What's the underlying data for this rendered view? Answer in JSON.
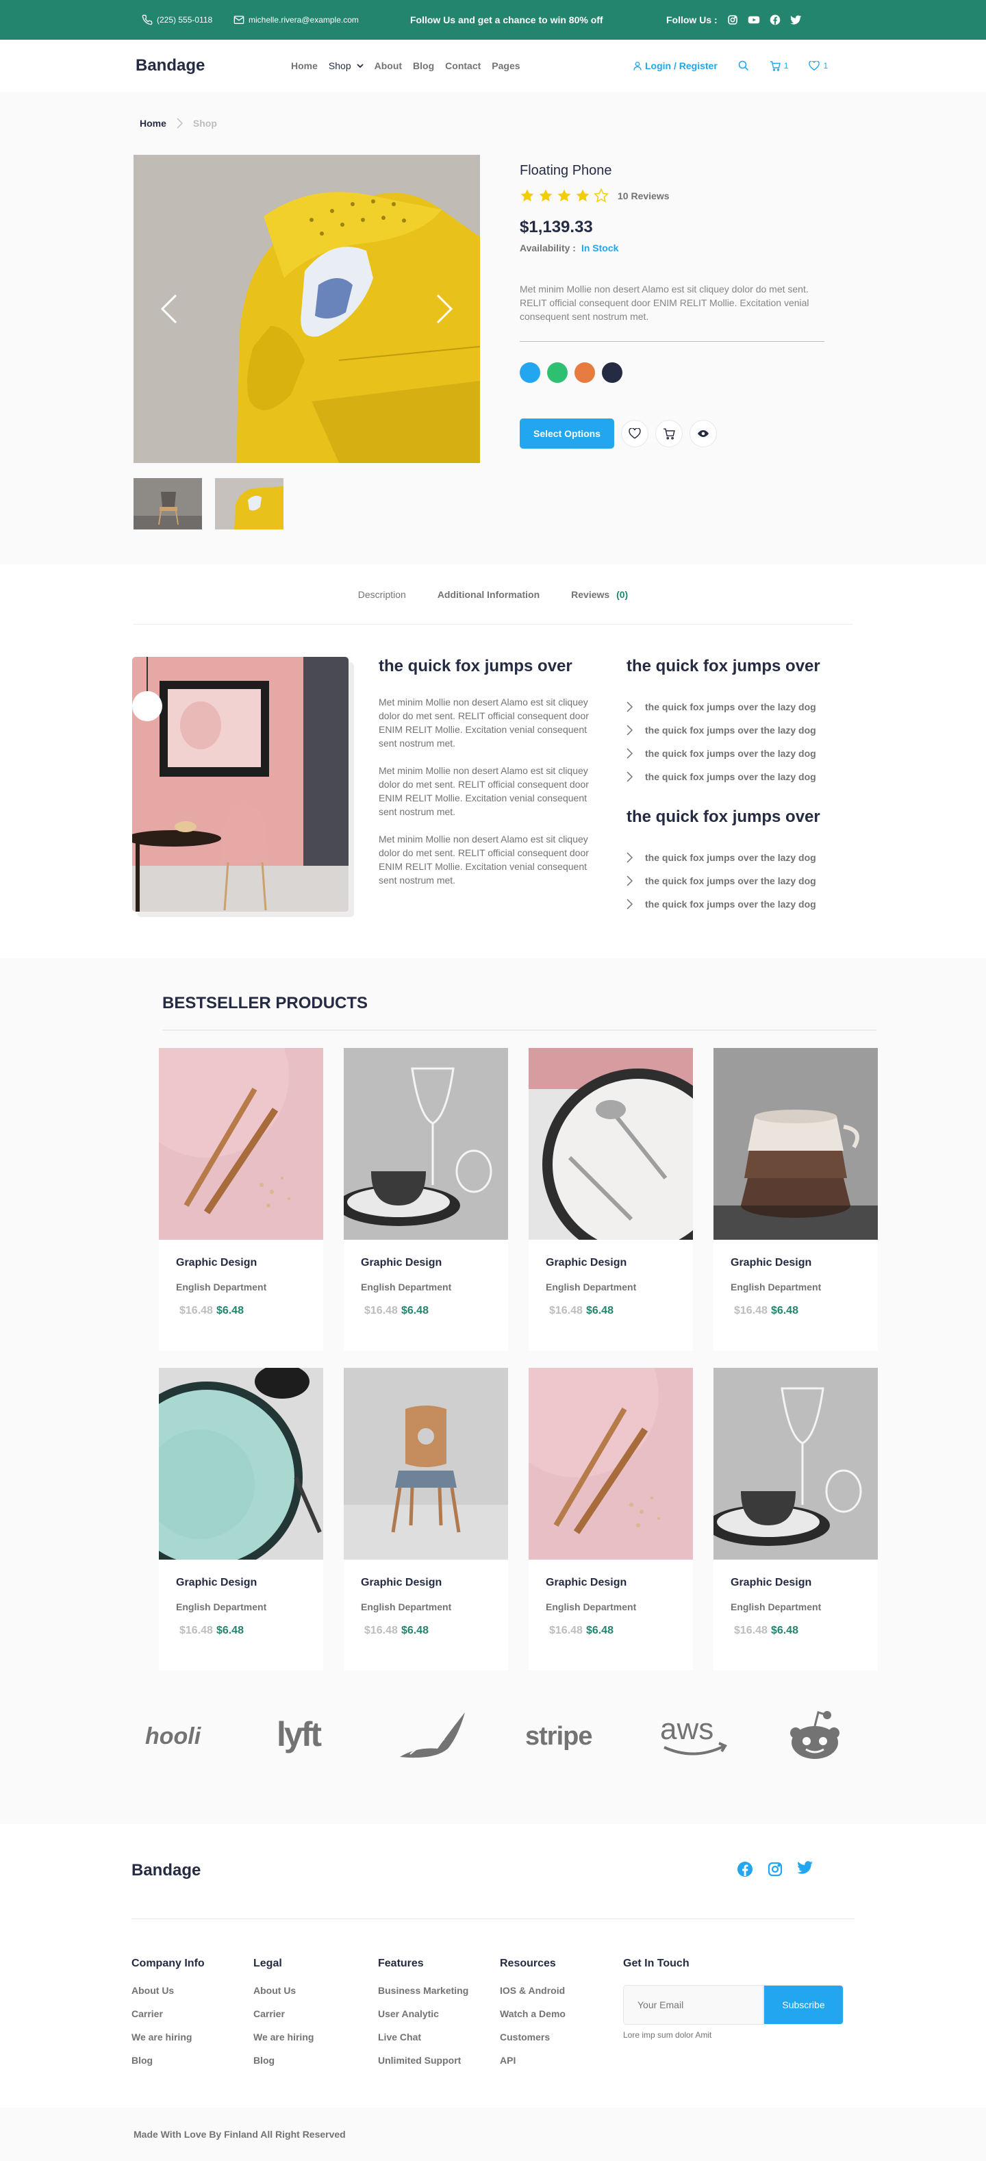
{
  "topbar": {
    "phone": "(225) 555-0118",
    "email": "michelle.rivera@example.com",
    "promo": "Follow Us  and get a chance to win 80% off",
    "follow_label": "Follow Us :"
  },
  "header": {
    "brand": "Bandage",
    "nav": {
      "home": "Home",
      "shop": "Shop",
      "about": "About",
      "blog": "Blog",
      "contact": "Contact",
      "pages": "Pages"
    },
    "login": "Login / Register",
    "cart_count": "1",
    "wishlist_count": "1"
  },
  "breadcrumb": {
    "home": "Home",
    "current": "Shop"
  },
  "product": {
    "name": "Floating Phone",
    "rating": 4,
    "reviews": "10 Reviews",
    "price": "$1,139.33",
    "availability_label": "Availability  :",
    "availability_value": "In Stock",
    "description": "Met minim Mollie non desert Alamo est sit cliquey dolor do met sent. RELIT official consequent door ENIM RELIT Mollie. Excitation venial consequent sent nostrum met.",
    "colors": [
      "#23A6F0",
      "#2DC071",
      "#E77C40",
      "#252B42"
    ],
    "select_options": "Select Options"
  },
  "tabs": {
    "description": "Description",
    "additional": "Additional Information",
    "reviews": "Reviews",
    "reviews_count": "(0)"
  },
  "details": {
    "heading": "the quick fox jumps over",
    "paragraphs": [
      "Met minim Mollie non desert Alamo est sit cliquey dolor do met sent. RELIT official consequent door ENIM RELIT Mollie. Excitation venial consequent sent nostrum met.",
      "Met minim Mollie non desert Alamo est sit cliquey dolor do met sent. RELIT official consequent door ENIM RELIT Mollie. Excitation venial consequent sent nostrum met.",
      "Met minim Mollie non desert Alamo est sit cliquey dolor do met sent. RELIT official consequent door ENIM RELIT Mollie. Excitation venial consequent sent nostrum met."
    ],
    "list_heading_1": "the quick fox jumps over",
    "list_1": [
      "the quick fox jumps over the lazy dog",
      "the quick fox jumps over the lazy dog",
      "the quick fox jumps over the lazy dog",
      "the quick fox jumps over the lazy dog"
    ],
    "list_heading_2": "the quick fox jumps over",
    "list_2": [
      "the quick fox jumps over the lazy dog",
      "the quick fox jumps over the lazy dog",
      "the quick fox jumps over the lazy dog"
    ]
  },
  "bestseller": {
    "title": "BESTSELLER PRODUCTS",
    "products": [
      {
        "title": "Graphic Design",
        "dept": "English Department",
        "old": "$16.48",
        "new": "$6.48"
      },
      {
        "title": "Graphic Design",
        "dept": "English Department",
        "old": "$16.48",
        "new": "$6.48"
      },
      {
        "title": "Graphic Design",
        "dept": "English Department",
        "old": "$16.48",
        "new": "$6.48"
      },
      {
        "title": "Graphic Design",
        "dept": "English Department",
        "old": "$16.48",
        "new": "$6.48"
      },
      {
        "title": "Graphic Design",
        "dept": "English Department",
        "old": "$16.48",
        "new": "$6.48"
      },
      {
        "title": "Graphic Design",
        "dept": "English Department",
        "old": "$16.48",
        "new": "$6.48"
      },
      {
        "title": "Graphic Design",
        "dept": "English Department",
        "old": "$16.48",
        "new": "$6.48"
      },
      {
        "title": "Graphic Design",
        "dept": "English Department",
        "old": "$16.48",
        "new": "$6.48"
      }
    ],
    "logos": [
      "hooli",
      "lyft",
      "stripe",
      "aws"
    ]
  },
  "footer": {
    "brand": "Bandage",
    "columns": [
      {
        "title": "Company Info",
        "items": [
          "About Us",
          "Carrier",
          "We are hiring",
          "Blog"
        ]
      },
      {
        "title": "Legal",
        "items": [
          "About Us",
          "Carrier",
          "We are hiring",
          "Blog"
        ]
      },
      {
        "title": "Features",
        "items": [
          "Business Marketing",
          "User Analytic",
          "Live Chat",
          "Unlimited Support"
        ]
      },
      {
        "title": "Resources",
        "items": [
          "IOS & Android",
          "Watch a Demo",
          "Customers",
          "API"
        ]
      }
    ],
    "touch_title": "Get In Touch",
    "email_placeholder": "Your Email",
    "subscribe": "Subscribe",
    "note": "Lore imp sum dolor Amit",
    "copyright": "Made With Love By Finland All Right Reserved"
  }
}
